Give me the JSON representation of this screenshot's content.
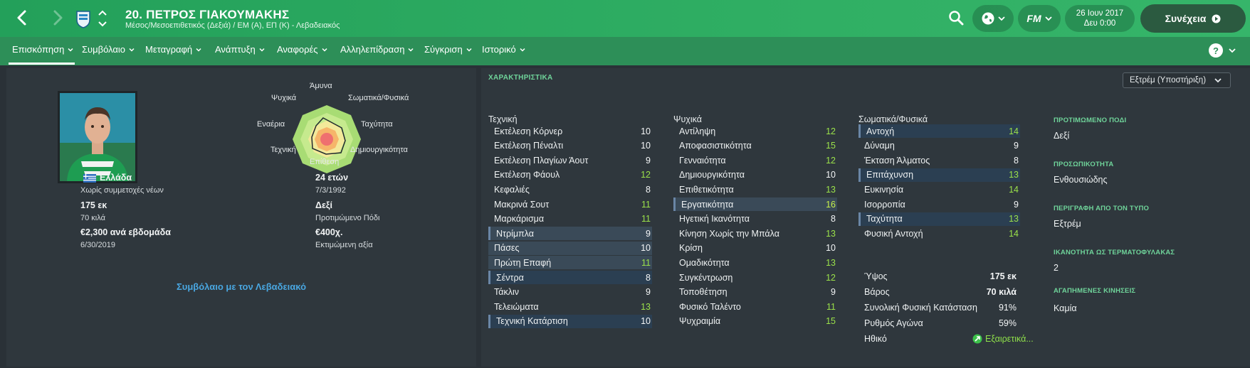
{
  "header": {
    "player_name": "20. ΠΕΤΡΟΣ ΓΙΑΚΟΥΜΑΚΗΣ",
    "player_subtitle": "Μέσος/Μεσοεπιθετικός (Δεξιά) / ΕΜ (Α), ΕΠ (Κ) - Λεβαδειακός",
    "date": "26 Ιουν 2017",
    "time": "Δευ 0:00",
    "continue_label": "Συνέχεια",
    "fm_label": "FM",
    "accent_color": "#2fae63"
  },
  "tabs": [
    {
      "label": "Επισκόπηση"
    },
    {
      "label": "Συμβόλαιο"
    },
    {
      "label": "Μεταγραφή"
    },
    {
      "label": "Ανάπτυξη"
    },
    {
      "label": "Αναφορές"
    },
    {
      "label": "Αλληλεπίδραση"
    },
    {
      "label": "Σύγκριση"
    },
    {
      "label": "Ιστορικό"
    }
  ],
  "profile": {
    "nation": "Ελλάδα",
    "youth_caps": "Χωρίς συμμετοχές νέων",
    "height": "175 εκ",
    "weight": "70 κιλά",
    "wage": "€2,300 ανά εβδομάδα",
    "contract_end": "6/30/2019",
    "age": "24 ετών",
    "dob": "7/3/1992",
    "preferred_foot": "Δεξί",
    "preferred_foot_label": "Προτιμώμενο Πόδι",
    "value": "€400χ.",
    "value_label": "Εκτιμώμενη αξία",
    "contract_link": "Συμβόλαιο με τον Λεβαδειακό"
  },
  "radar": {
    "top": "Άμυνα",
    "top_right": "Σωματικά/Φυσικά",
    "right": "Ταχύτητα",
    "bottom_right": "Δημιουργικότητα",
    "bottom": "Επίθεση",
    "bottom_left": "Τεχνική",
    "left": "Εναέρια",
    "top_left": "Ψυχικά"
  },
  "attributes": {
    "title": "ΧΑΡΑΚΤΗΡΙΣΤΙΚΑ",
    "role": "Εξτρέμ (Υποστήριξη)",
    "technical_head": "Τεχνική",
    "mental_head": "Ψυχικά",
    "physical_head": "Σωματικά/Φυσικά",
    "technical": [
      {
        "name": "Εκτέλεση Κόρνερ",
        "value": "10"
      },
      {
        "name": "Εκτέλεση Πέναλτι",
        "value": "10"
      },
      {
        "name": "Εκτέλεση Πλαγίων Άουτ",
        "value": "9"
      },
      {
        "name": "Εκτέλεση Φάουλ",
        "value": "12"
      },
      {
        "name": "Κεφαλιές",
        "value": "8"
      },
      {
        "name": "Μακρινά Σουτ",
        "value": "11"
      },
      {
        "name": "Μαρκάρισμα",
        "value": "11"
      },
      {
        "name": "Ντρίμπλα",
        "value": "9"
      },
      {
        "name": "Πάσες",
        "value": "10"
      },
      {
        "name": "Πρώτη Επαφή",
        "value": "11"
      },
      {
        "name": "Σέντρα",
        "value": "8"
      },
      {
        "name": "Τάκλιν",
        "value": "9"
      },
      {
        "name": "Τελειώματα",
        "value": "13"
      },
      {
        "name": "Τεχνική Κατάρτιση",
        "value": "10"
      }
    ],
    "mental": [
      {
        "name": "Αντίληψη",
        "value": "12"
      },
      {
        "name": "Αποφασιστικότητα",
        "value": "15"
      },
      {
        "name": "Γενναιότητα",
        "value": "12"
      },
      {
        "name": "Δημιουργικότητα",
        "value": "10"
      },
      {
        "name": "Επιθετικότητα",
        "value": "13"
      },
      {
        "name": "Εργατικότητα",
        "value": "16"
      },
      {
        "name": "Ηγετική Ικανότητα",
        "value": "8"
      },
      {
        "name": "Κίνηση Χωρίς την Μπάλα",
        "value": "13"
      },
      {
        "name": "Κρίση",
        "value": "10"
      },
      {
        "name": "Ομαδικότητα",
        "value": "13"
      },
      {
        "name": "Συγκέντρωση",
        "value": "12"
      },
      {
        "name": "Τοποθέτηση",
        "value": "9"
      },
      {
        "name": "Φυσικό Ταλέντο",
        "value": "11"
      },
      {
        "name": "Ψυχραιμία",
        "value": "15"
      }
    ],
    "physical": [
      {
        "name": "Αντοχή",
        "value": "14"
      },
      {
        "name": "Δύναμη",
        "value": "9"
      },
      {
        "name": "Έκταση Άλματος",
        "value": "8"
      },
      {
        "name": "Επιτάχυνση",
        "value": "13"
      },
      {
        "name": "Ευκινησία",
        "value": "14"
      },
      {
        "name": "Ισορροπία",
        "value": "9"
      },
      {
        "name": "Ταχύτητα",
        "value": "13"
      },
      {
        "name": "Φυσική Αντοχή",
        "value": "14"
      }
    ],
    "stats": [
      {
        "label": "Ύψος",
        "value": "175 εκ"
      },
      {
        "label": "Βάρος",
        "value": "70 κιλά"
      },
      {
        "label": "Συνολική Φυσική Κατάσταση",
        "value": "91%"
      },
      {
        "label": "Ρυθμός Αγώνα",
        "value": "59%"
      },
      {
        "label": "Ηθικό",
        "value": "Εξαιρετικά..."
      }
    ]
  },
  "side": {
    "foot_head": "ΠΡΟΤΙΜΩΜΕΝΟ ΠΟΔΙ",
    "foot_val": "Δεξί",
    "personality_head": "ΠΡΟΣΩΠΙΚΟΤΗΤΑ",
    "personality_val": "Ενθουσιώδης",
    "media_head": "ΠΕΡΙΓΡΑΦΗ ΑΠΟ ΤΟΝ ΤΥΠΟ",
    "media_val": "Εξτρέμ",
    "gk_head": "ΙΚΑΝΟΤΗΤΑ ΩΣ ΤΕΡΜΑΤΟΦΥΛΑΚΑΣ",
    "gk_val": "2",
    "moves_head": "ΑΓΑΠΗΜΕΝΕΣ ΚΙΝΗΣΕΙΣ",
    "moves_val": "Καμία"
  }
}
